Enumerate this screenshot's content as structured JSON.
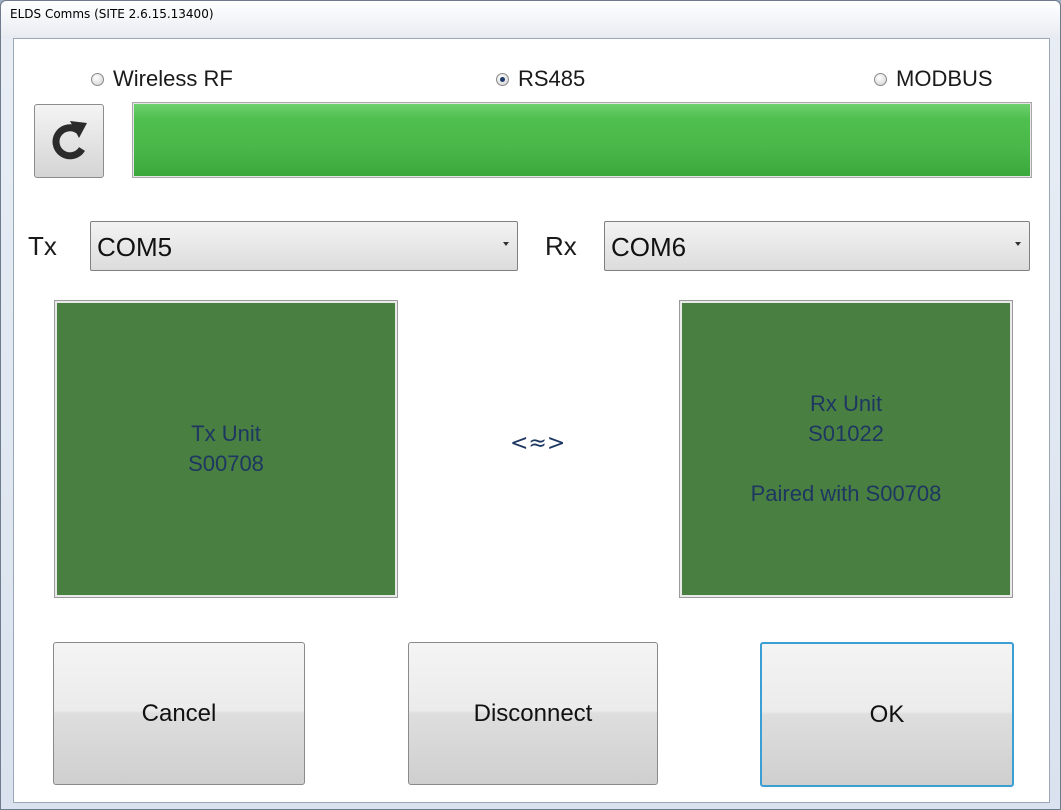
{
  "window": {
    "title": "ELDS Comms (SITE 2.6.15.13400)"
  },
  "connection": {
    "options": [
      "Wireless RF",
      "RS485",
      "MODBUS"
    ],
    "selected": "RS485"
  },
  "progress": {
    "value_percent": 100,
    "color": "#4fc04f"
  },
  "ports": {
    "tx_label": "Tx",
    "tx_value": "COM5",
    "rx_label": "Rx",
    "rx_value": "COM6"
  },
  "tx_unit": {
    "line1": "Tx Unit",
    "line2": "S00708"
  },
  "link_symbol": "<≈>",
  "rx_unit": {
    "line1": "Rx Unit",
    "line2": "S01022",
    "line3": "Paired with S00708"
  },
  "buttons": {
    "cancel": "Cancel",
    "disconnect": "Disconnect",
    "ok": "OK"
  },
  "icons": {
    "refresh": "refresh-icon"
  },
  "colors": {
    "unit_bg": "#4a7f42",
    "unit_text": "#1d3761",
    "ok_border": "#3c9fd3"
  }
}
